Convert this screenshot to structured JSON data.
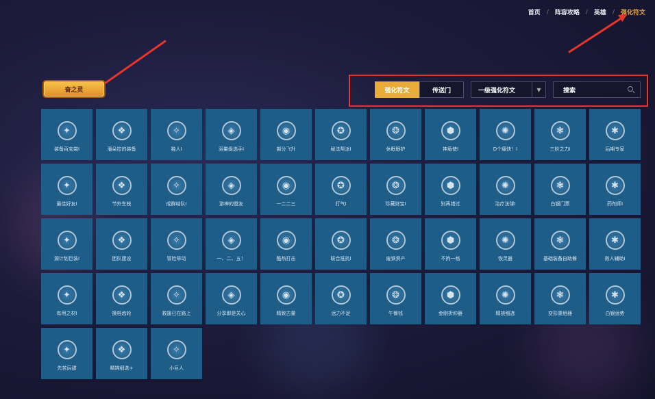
{
  "nav": {
    "items": [
      {
        "label": "首页",
        "active": false
      },
      {
        "label": "阵容攻略",
        "active": false
      },
      {
        "label": "英雄",
        "active": false
      },
      {
        "label": "强化符文",
        "active": true
      }
    ]
  },
  "badge": {
    "label": "奋之灵"
  },
  "filters": {
    "tabs": [
      {
        "label": "强化符文",
        "active": true
      },
      {
        "label": "传送门",
        "active": false
      }
    ],
    "select_value": "一级强化符文",
    "search_placeholder": "搜索"
  },
  "colors": {
    "accent": "#e9ac38",
    "card_bg": "#1d5d88",
    "annotation_red": "#e8352b",
    "nav_active": "#e6a53a"
  },
  "cards": [
    {
      "label": "装备百宝袋Ⅰ",
      "icon": "bag-icon"
    },
    {
      "label": "潘朵拉的装备",
      "icon": "box-icon"
    },
    {
      "label": "独人Ⅰ",
      "icon": "rocket-icon"
    },
    {
      "label": "羽量级选手Ⅰ",
      "icon": "feather-icon"
    },
    {
      "label": "部分飞升",
      "icon": "clock-icon"
    },
    {
      "label": "秘法帮派Ⅰ",
      "icon": "arcane-icon"
    },
    {
      "label": "休眠眼护",
      "icon": "anvil-icon"
    },
    {
      "label": "神盾使Ⅰ",
      "icon": "shield-icon"
    },
    {
      "label": "D个痛快！Ⅰ",
      "icon": "spiral-icon"
    },
    {
      "label": "三阶之力Ⅰ",
      "icon": "card-icon"
    },
    {
      "label": "后期专家",
      "icon": "hat-icon"
    },
    {
      "label": "最佳好友Ⅰ",
      "icon": "friends-icon"
    },
    {
      "label": "节外生枝",
      "icon": "branch-icon"
    },
    {
      "label": "成群结队Ⅰ",
      "icon": "group-icon"
    },
    {
      "label": "游神的盟友",
      "icon": "ally-icon"
    },
    {
      "label": "一二二三",
      "icon": "cards-icon"
    },
    {
      "label": "打气Ⅰ",
      "icon": "pump-icon"
    },
    {
      "label": "珍藏财宝Ⅰ",
      "icon": "treasure-icon"
    },
    {
      "label": "别再错过",
      "icon": "miss-icon"
    },
    {
      "label": "治疗法球Ⅰ",
      "icon": "orb-icon"
    },
    {
      "label": "白银门票",
      "icon": "ticket-icon"
    },
    {
      "label": "药剂师Ⅰ",
      "icon": "potion-icon"
    },
    {
      "label": "源计划巨装Ⅰ",
      "icon": "mech-icon"
    },
    {
      "label": "团队建设",
      "icon": "team-icon"
    },
    {
      "label": "冒险举动",
      "icon": "risk-icon"
    },
    {
      "label": "一、二、五！",
      "icon": "fingers-icon"
    },
    {
      "label": "酷热打击",
      "icon": "fire-icon"
    },
    {
      "label": "联合抵抗Ⅰ",
      "icon": "guard-icon"
    },
    {
      "label": "废铁资产",
      "icon": "scrap-icon"
    },
    {
      "label": "不拘一格",
      "icon": "style-icon"
    },
    {
      "label": "恢灵器",
      "icon": "relic-icon"
    },
    {
      "label": "基础装备自助餐",
      "icon": "buffet-icon"
    },
    {
      "label": "救人辅助Ⅰ",
      "icon": "rescue-icon"
    },
    {
      "label": "有用之材Ⅰ",
      "icon": "material-icon"
    },
    {
      "label": "换档齿轮",
      "icon": "gear-icon"
    },
    {
      "label": "救援已在路上",
      "icon": "help-icon"
    },
    {
      "label": "分享即是关心",
      "icon": "share-icon"
    },
    {
      "label": "精致古董",
      "icon": "antique-icon"
    },
    {
      "label": "远力不足",
      "icon": "power-icon"
    },
    {
      "label": "午餐钱",
      "icon": "coin-icon"
    },
    {
      "label": "金刚折抑器",
      "icon": "hammer-icon"
    },
    {
      "label": "精挑细选",
      "icon": "pick-icon"
    },
    {
      "label": "变形重组器",
      "icon": "reforge-icon"
    },
    {
      "label": "白银运势",
      "icon": "fortune-icon"
    },
    {
      "label": "先苦后甜",
      "icon": "sweet-icon"
    },
    {
      "label": "精挑细选+",
      "icon": "pick-plus-icon"
    },
    {
      "label": "小巨人",
      "icon": "giant-icon"
    }
  ]
}
